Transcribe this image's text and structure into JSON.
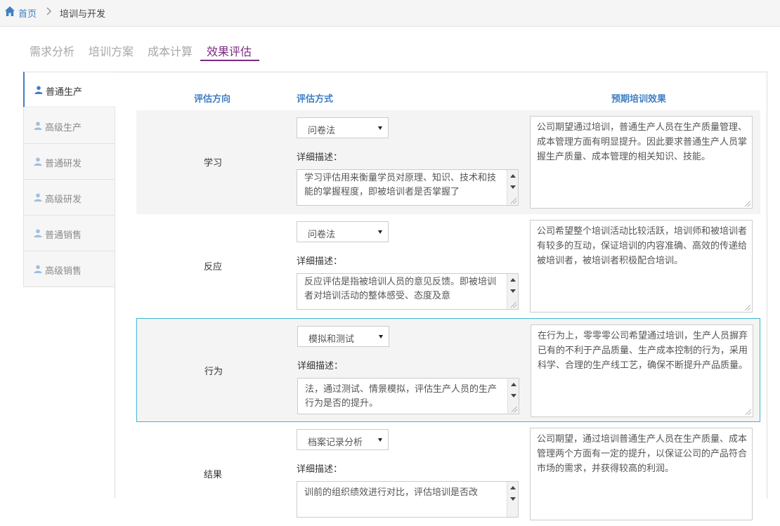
{
  "breadcrumb": {
    "home": "首页",
    "current": "培训与开发"
  },
  "tabs": [
    "需求分析",
    "培训方案",
    "成本计算",
    "效果评估"
  ],
  "active_tab": "效果评估",
  "sidebar": {
    "items": [
      {
        "label": "普通生产",
        "active": true
      },
      {
        "label": "高级生产"
      },
      {
        "label": "普通研发"
      },
      {
        "label": "高级研发"
      },
      {
        "label": "普通销售"
      },
      {
        "label": "高级销售"
      }
    ]
  },
  "columns": {
    "direction": "评估方向",
    "method": "评估方式",
    "effect": "预期培训效果"
  },
  "detail_label": "详细描述：",
  "rows": [
    {
      "direction": "学习",
      "method": "问卷法",
      "description": "学习评估用来衡量学员对原理、知识、技术和技能的掌握程度，即被培训者是否掌握了",
      "effect": "公司期望通过培训，普通生产人员在生产质量管理、成本管理方面有明显提升。因此要求普通生产人员掌握生产质量、成本管理的相关知识、技能。"
    },
    {
      "direction": "反应",
      "method": "问卷法",
      "description": "反应评估是指被培训人员的意见反馈。即被培训者对培训活动的整体感受、态度及意",
      "effect": "公司希望整个培训活动比较活跃，培训师和被培训者有较多的互动，保证培训的内容准确、高效的传递给被培训者，被培训者积极配合培训。"
    },
    {
      "direction": "行为",
      "method": "模拟和测试",
      "description": "法，通过测试、情景模拟，评估生产人员的生产行为是否的提升。",
      "effect": "在行为上，零零零公司希望通过培训，生产人员摒弃已有的不利于产品质量、生产成本控制的行为，采用科学、合理的生产线工艺，确保不断提升产品质量。"
    },
    {
      "direction": "结果",
      "method": "档案记录分析",
      "description": "训前的组织绩效进行对比，评估培训是否改",
      "effect": "公司期望，通过培训普通生产人员在生产质量、成本管理两个方面有一定的提升，以保证公司的产品符合市场的需求，并获得较高的利润。"
    }
  ],
  "colors": {
    "accent": "#3f7fc5",
    "tab_active": "#7b2a82",
    "selected_border": "#3bb8d3"
  }
}
